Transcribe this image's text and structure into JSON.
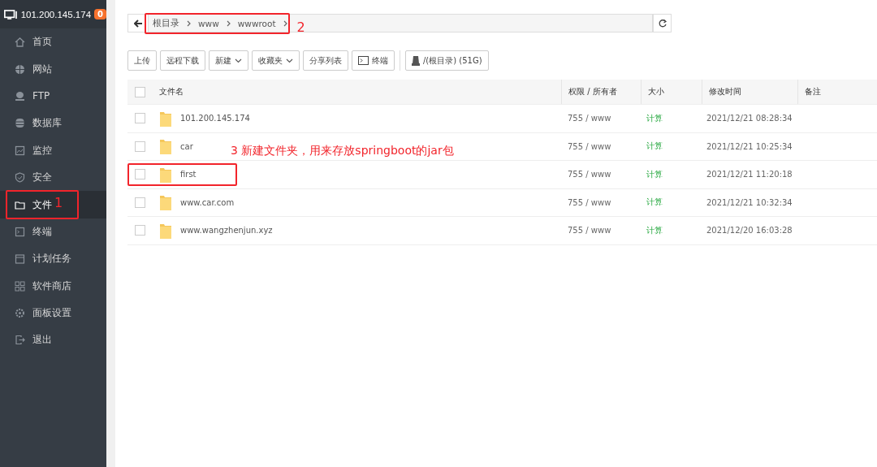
{
  "sidebar": {
    "server": "101.200.145.174",
    "badge": "0",
    "items": [
      {
        "label": "首页",
        "selected": false
      },
      {
        "label": "网站",
        "selected": false
      },
      {
        "label": "FTP",
        "selected": false
      },
      {
        "label": "数据库",
        "selected": false
      },
      {
        "label": "监控",
        "selected": false
      },
      {
        "label": "安全",
        "selected": false
      },
      {
        "label": "文件",
        "selected": true
      },
      {
        "label": "终端",
        "selected": false
      },
      {
        "label": "计划任务",
        "selected": false
      },
      {
        "label": "软件商店",
        "selected": false
      },
      {
        "label": "面板设置",
        "selected": false
      },
      {
        "label": "退出",
        "selected": false
      }
    ]
  },
  "path": {
    "crumbs": [
      "根目录",
      "www",
      "wwwroot"
    ]
  },
  "toolbar": [
    {
      "label": "上传",
      "kind": "plain"
    },
    {
      "label": "远程下载",
      "kind": "plain"
    },
    {
      "label": "新建",
      "kind": "dropdown"
    },
    {
      "label": "收藏夹",
      "kind": "dropdown"
    },
    {
      "label": "分享列表",
      "kind": "plain"
    },
    {
      "label": "终端",
      "kind": "terminal"
    },
    {
      "label": "/(根目录) (51G)",
      "kind": "disk"
    }
  ],
  "table": {
    "select_all_checked": false,
    "columns": [
      "文件名",
      "权限 / 所有者",
      "大小",
      "修改时间",
      "备注"
    ],
    "rows": [
      {
        "name": "101.200.145.174",
        "perm": "755 / www",
        "size": "计算",
        "time": "2021/12/21 08:28:34",
        "checked": false
      },
      {
        "name": "car",
        "perm": "755 / www",
        "size": "计算",
        "time": "2021/12/21 10:25:34",
        "checked": false
      },
      {
        "name": "first",
        "perm": "755 / www",
        "size": "计算",
        "time": "2021/12/21 11:20:18",
        "checked": false
      },
      {
        "name": "www.car.com",
        "perm": "755 / www",
        "size": "计算",
        "time": "2021/12/21 10:32:34",
        "checked": false
      },
      {
        "name": "www.wangzhenjun.xyz",
        "perm": "755 / www",
        "size": "计算",
        "time": "2021/12/20 16:03:28",
        "checked": false
      }
    ]
  },
  "annotations": [
    {
      "text": "1",
      "kind": "nav"
    },
    {
      "text": "2",
      "kind": "path"
    },
    {
      "text": "3  新建文件夹，用来存放springboot的jar包",
      "kind": "row"
    }
  ]
}
